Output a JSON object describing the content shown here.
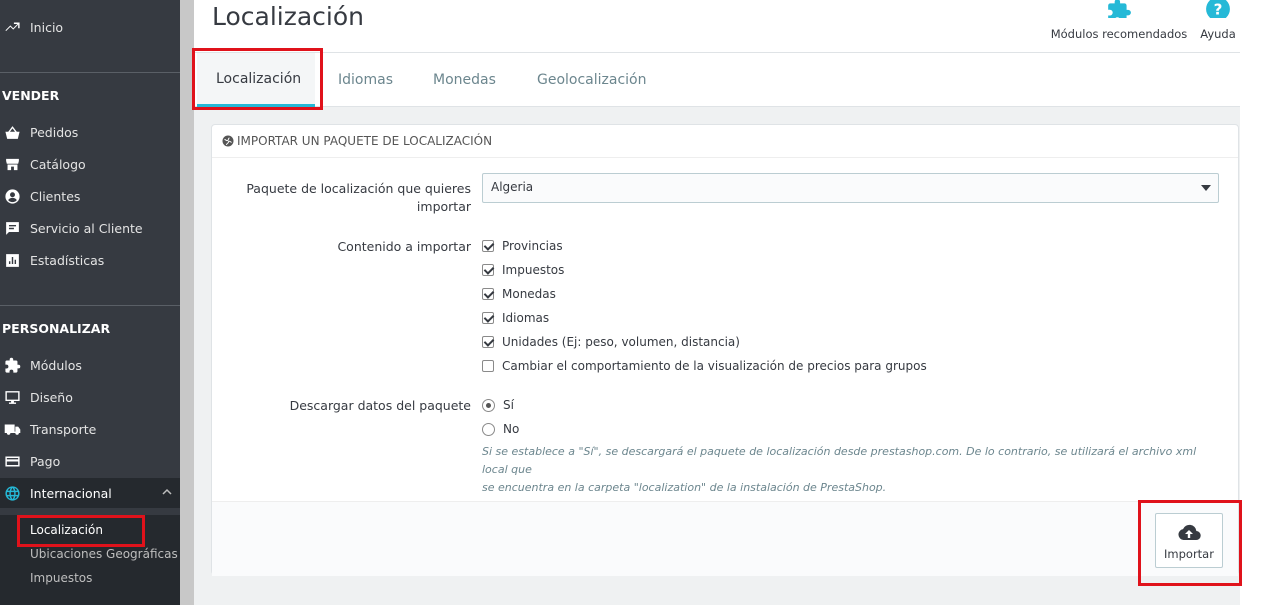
{
  "sidebar": {
    "home": "Inicio",
    "sections": [
      {
        "title": "VENDER",
        "items": [
          "Pedidos",
          "Catálogo",
          "Clientes",
          "Servicio al Cliente",
          "Estadísticas"
        ]
      },
      {
        "title": "PERSONALIZAR",
        "items": [
          "Módulos",
          "Diseño",
          "Transporte",
          "Pago",
          "Internacional"
        ]
      }
    ],
    "submenu": [
      "Localización",
      "Ubicaciones Geográficas",
      "Impuestos"
    ]
  },
  "header": {
    "title": "Localización",
    "modules_label": "Módulos recomendados",
    "help_label": "Ayuda"
  },
  "tabs": [
    "Localización",
    "Idiomas",
    "Monedas",
    "Geolocalización"
  ],
  "panel": {
    "heading": "IMPORTAR UN PAQUETE DE LOCALIZACIÓN",
    "package_label_line1": "Paquete de localización que quieres",
    "package_label_line2": "importar",
    "package_value": "Algeria",
    "content_label": "Contenido a importar",
    "content_options": [
      {
        "label": "Provincias",
        "checked": true
      },
      {
        "label": "Impuestos",
        "checked": true
      },
      {
        "label": "Monedas",
        "checked": true
      },
      {
        "label": "Idiomas",
        "checked": true
      },
      {
        "label": "Unidades (Ej: peso, volumen, distancia)",
        "checked": true
      },
      {
        "label": "Cambiar el comportamiento de la visualización de precios para grupos",
        "checked": false
      }
    ],
    "download_label": "Descargar datos del paquete",
    "download_options": [
      {
        "label": "Sí",
        "selected": true
      },
      {
        "label": "No",
        "selected": false
      }
    ],
    "help_line1": "Si se establece a \"Sí\", se descargará el paquete de localización desde prestashop.com. De lo contrario, se utilizará el archivo xml local que",
    "help_line2": "se encuentra en la carpeta \"localization\" de la instalación de PrestaShop.",
    "import_label": "Importar"
  },
  "colors": {
    "sidebar_bg": "#363a41",
    "accent": "#25b9d7",
    "highlight": "#e0121b"
  }
}
